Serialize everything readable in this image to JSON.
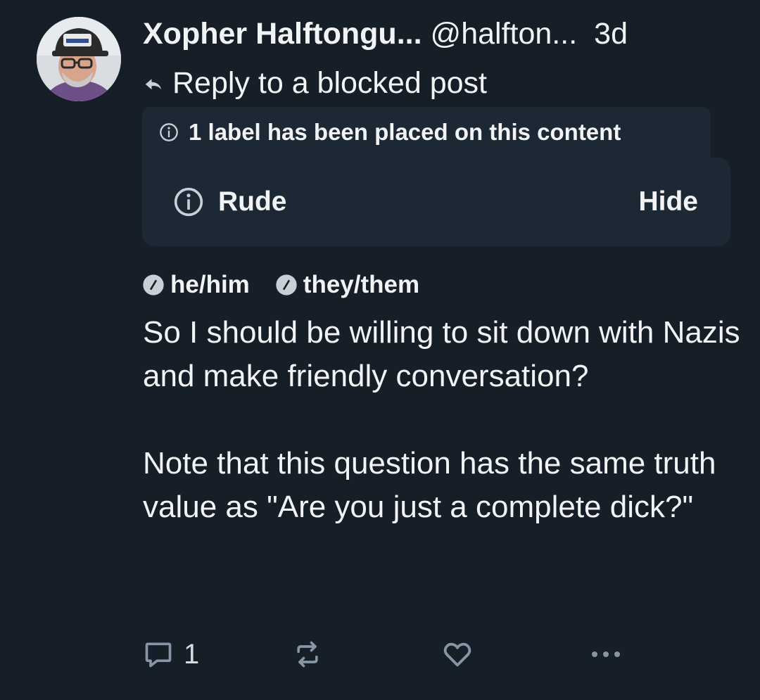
{
  "post": {
    "author": {
      "display_name": "Xopher Halftongu...",
      "handle": "@halfton...",
      "avatar_icon": "user-avatar-photo"
    },
    "timestamp": "3d",
    "reply_context": {
      "icon": "reply-arrow-icon",
      "text": "Reply to a blocked post"
    },
    "moderation": {
      "notice_icon": "info-icon",
      "notice_text": "1 label has been placed on this content",
      "labels": [
        {
          "icon": "info-icon",
          "name": "Rude",
          "action": "Hide"
        }
      ]
    },
    "pronouns": [
      {
        "icon": "pronoun-badge-icon",
        "text": "he/him"
      },
      {
        "icon": "pronoun-badge-icon",
        "text": "they/them"
      }
    ],
    "body": "So I should be willing to sit down with Nazis and make friendly conversation?\n\nNote that this question has the same truth value as \"Are you just a complete dick?\"",
    "actions": {
      "reply": {
        "icon": "comment-icon",
        "count": "1"
      },
      "repost": {
        "icon": "repost-icon"
      },
      "like": {
        "icon": "heart-icon"
      },
      "more": {
        "icon": "more-options-icon"
      }
    }
  },
  "colors": {
    "background": "#161e27",
    "panel": "#1d2835",
    "text": "#f1f3f5",
    "icon": "#8796a6"
  }
}
